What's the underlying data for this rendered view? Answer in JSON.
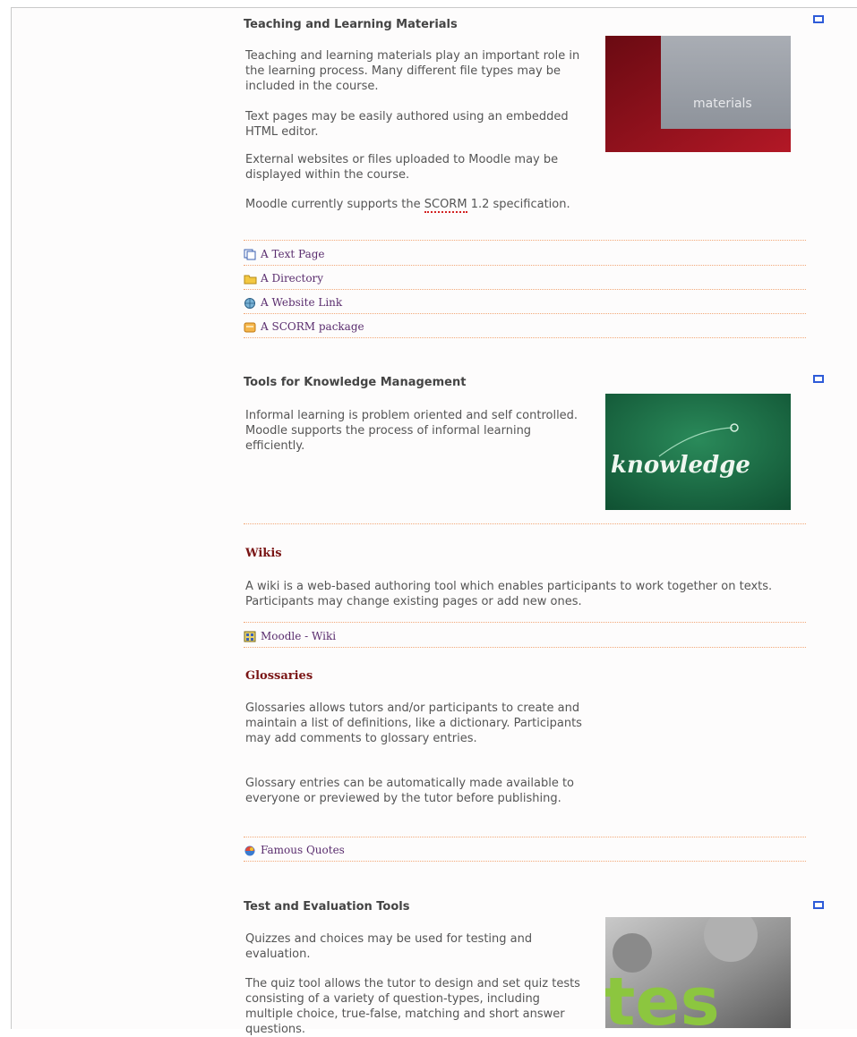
{
  "sections": [
    {
      "title": "Teaching and Learning Materials",
      "paragraphs": [
        "Teaching and learning materials play an important role in the learning process. Many different file types may be included in the course.",
        "Text pages may be easily authored using an embedded HTML editor.",
        "External websites or files uploaded to Moodle may be displayed within the course.",
        "Moodle currently supports the SCORM 1.2 specification."
      ],
      "image_text": "materials",
      "resources": [
        {
          "label": "A Text Page",
          "icon": "text-page-icon"
        },
        {
          "label": "A Directory",
          "icon": "folder-icon"
        },
        {
          "label": "A Website Link",
          "icon": "web-link-icon"
        },
        {
          "label": "A SCORM package",
          "icon": "scorm-package-icon"
        }
      ]
    },
    {
      "title": "Tools for Knowledge Management",
      "paragraphs": [
        "Informal learning is problem oriented and self controlled. Moodle supports the process of informal learning efficiently."
      ],
      "image_text": "knowledge",
      "subsections": [
        {
          "title": "Wikis",
          "paragraphs": [
            "A wiki is a web-based authoring tool which enables participants to work together on texts. Participants may change existing pages or add new ones."
          ],
          "resources": [
            {
              "label": "Moodle - Wiki",
              "icon": "wiki-icon"
            }
          ]
        },
        {
          "title": "Glossaries",
          "paragraphs": [
            "Glossaries allows tutors and/or participants to create and maintain a list of definitions, like a dictionary. Participants may add comments to glossary entries.",
            "Glossary entries can be automatically made available to everyone or previewed by the tutor before publishing."
          ],
          "resources": [
            {
              "label": "Famous Quotes",
              "icon": "glossary-icon"
            }
          ]
        }
      ]
    },
    {
      "title": "Test and Evaluation Tools",
      "paragraphs": [
        "Quizzes and choices may be used for testing and evaluation.",
        "The quiz tool allows the tutor to design and set quiz tests consisting of a variety of question-types, including multiple choice, true-false, matching and short answer questions."
      ],
      "image_text": "tes"
    }
  ],
  "colors": {
    "link": "#5a2d6e",
    "subheading": "#7a1515",
    "divider": "#f2a878",
    "toggle": "#2e5bd8"
  }
}
